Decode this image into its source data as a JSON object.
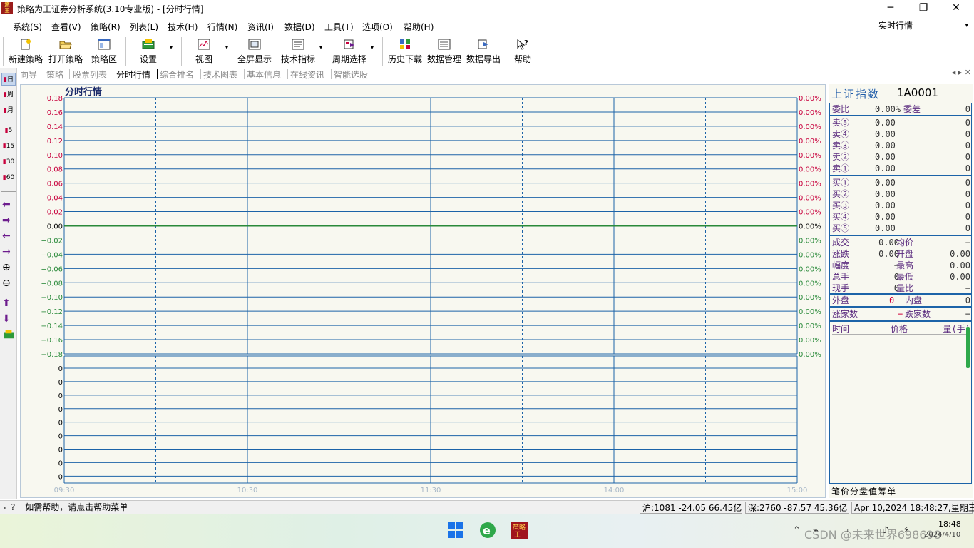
{
  "window": {
    "title": "策略为王证券分析系统(3.10专业版) - [分时行情]",
    "icon_text": "策略\n王",
    "minimize_glyph": "─",
    "maximize_glyph": "❐",
    "close_glyph": "✕"
  },
  "menu": {
    "items": [
      "系统(S)",
      "查看(V)",
      "策略(R)",
      "列表(L)",
      "技术(H)",
      "行情(N)",
      "资讯(I)",
      "数据(D)",
      "工具(T)",
      "选项(O)",
      "帮助(H)"
    ],
    "realtime_select": "实时行情",
    "realtime_arrow": "▾"
  },
  "toolbar": {
    "buttons": [
      "新建策略",
      "打开策略",
      "策略区",
      "设置",
      "视图",
      "全屏显示",
      "技术指标",
      "周期选择",
      "历史下载",
      "数据管理",
      "数据导出",
      "帮助"
    ],
    "drop_glyph": "▾"
  },
  "leftbar": {
    "period_buttons": [
      "日",
      "周",
      "月",
      "5",
      "15",
      "30",
      "60"
    ],
    "arrows": [
      "⬅",
      "➡",
      "←",
      "→"
    ],
    "zoom_in": "⊕",
    "zoom_out": "⊖",
    "up": "⬆",
    "down": "⬇"
  },
  "tabs": {
    "items": [
      "向导",
      "策略",
      "股票列表",
      "分时行情",
      "综合排名",
      "技术图表",
      "基本信息",
      "在线资讯",
      "智能选股"
    ],
    "active_index": 3,
    "nav": "◂ ▸ ✕"
  },
  "chart_data": {
    "type": "line",
    "title": "分时行情",
    "price_axis": {
      "ticks": [
        "0.18",
        "0.16",
        "0.14",
        "0.12",
        "0.10",
        "0.08",
        "0.06",
        "0.04",
        "0.02",
        "0.00",
        "−0.02",
        "−0.04",
        "−0.06",
        "−0.08",
        "−0.10",
        "−0.12",
        "−0.14",
        "−0.16",
        "−0.18"
      ],
      "ylim": [
        -0.18,
        0.18
      ]
    },
    "percent_axis": {
      "ticks": [
        "0.00%",
        "0.00%",
        "0.00%",
        "0.00%",
        "0.00%",
        "0.00%",
        "0.00%",
        "0.00%",
        "0.00%",
        "0.00%",
        "0.00%",
        "0.00%",
        "0.00%",
        "0.00%",
        "0.00%",
        "0.00%",
        "0.00%",
        "0.00%",
        "0.00%"
      ]
    },
    "volume_axis": {
      "ticks": [
        "0",
        "0",
        "0",
        "0",
        "0",
        "0",
        "0",
        "0",
        "0"
      ]
    },
    "time_axis": {
      "ticks": [
        "09:30",
        "10:30",
        "11:30",
        "14:00",
        "15:00"
      ]
    },
    "series": [
      {
        "values": [
          0.0,
          0.0
        ]
      }
    ],
    "grid": true,
    "colors": {
      "grid_line": "#1c63a8",
      "price_up": "#c8003c",
      "baseline": "#2a8a3a",
      "background": "#f8f8f0",
      "time_label": "#a8b8c8"
    }
  },
  "quote": {
    "title": "上证指数",
    "code": "1A0001",
    "commission": {
      "label1": "委比",
      "value1": "0.00%",
      "label2": "委差",
      "value2": "0"
    },
    "sell": [
      {
        "label": "卖⑤",
        "price": "0.00",
        "vol": "0"
      },
      {
        "label": "卖④",
        "price": "0.00",
        "vol": "0"
      },
      {
        "label": "卖③",
        "price": "0.00",
        "vol": "0"
      },
      {
        "label": "卖②",
        "price": "0.00",
        "vol": "0"
      },
      {
        "label": "卖①",
        "price": "0.00",
        "vol": "0"
      }
    ],
    "buy": [
      {
        "label": "买①",
        "price": "0.00",
        "vol": "0"
      },
      {
        "label": "买②",
        "price": "0.00",
        "vol": "0"
      },
      {
        "label": "买③",
        "price": "0.00",
        "vol": "0"
      },
      {
        "label": "买④",
        "price": "0.00",
        "vol": "0"
      },
      {
        "label": "买⑤",
        "price": "0.00",
        "vol": "0"
      }
    ],
    "stats": [
      {
        "l1": "成交",
        "v1": "0.00",
        "l2": "均价",
        "v2": "−"
      },
      {
        "l1": "涨跌",
        "v1": "0.00",
        "l2": "开盘",
        "v2": "0.00"
      },
      {
        "l1": "幅度",
        "v1": "−",
        "l2": "最高",
        "v2": "0.00"
      },
      {
        "l1": "总手",
        "v1": "0",
        "l2": "最低",
        "v2": "0.00"
      },
      {
        "l1": "现手",
        "v1": "0",
        "l2": "量比",
        "v2": "−"
      }
    ],
    "outer": {
      "l1": "外盘",
      "v1": "0",
      "l2": "内盘",
      "v2": "0"
    },
    "advance": {
      "l1": "涨家数",
      "v1": "−",
      "l2": "跌家数",
      "v2": "−"
    },
    "trades_header": {
      "time": "时间",
      "price": "价格",
      "volume": "量(手)"
    },
    "bottom_tabs": [
      "笔",
      "价",
      "分",
      "盘",
      "值",
      "筹",
      "单"
    ]
  },
  "status": {
    "help_icon": "⌐?",
    "help_text": "如需帮助，请点击帮助菜单",
    "sh": "沪:1081 -24.05 66.45亿",
    "sz": "深:2760 -87.57 45.36亿",
    "datetime": "Apr 10,2024 18:48:27,星期三"
  },
  "taskbar": {
    "time": "18:48",
    "date": "2024/4/10",
    "watermark": "CSDN @未来世界698698",
    "tray_glyphs": [
      "⌃",
      "⌁",
      "▭",
      "♪",
      "⚡"
    ]
  }
}
